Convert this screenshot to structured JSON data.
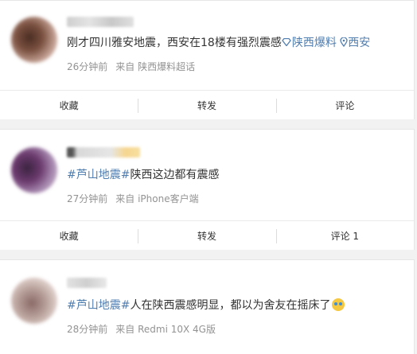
{
  "posts": [
    {
      "segments": [
        {
          "text": "刚才四川雅安地震，西安在18楼有强烈震感",
          "type": "plain"
        },
        {
          "text": "陕西爆料",
          "type": "link-blue",
          "icon": "diamond-icon"
        },
        {
          "text": " ",
          "type": "plain"
        },
        {
          "text": "西安",
          "type": "link-blue",
          "icon": "location-icon"
        }
      ],
      "time": "26分钟前",
      "source": "来自 陕西爆料超话",
      "actions": {
        "favorite": "收藏",
        "repost": "转发",
        "comment": "评论"
      }
    },
    {
      "segments": [
        {
          "text": "#芦山地震#",
          "type": "link-blue"
        },
        {
          "text": "陕西这边都有震感",
          "type": "plain"
        }
      ],
      "name_prefix": "N",
      "time": "27分钟前",
      "source": "来自 iPhone客户端",
      "actions": {
        "favorite": "收藏",
        "repost": "转发",
        "comment": "评论 1"
      }
    },
    {
      "segments": [
        {
          "text": "#芦山地震#",
          "type": "link-blue"
        },
        {
          "text": "人在陕西震感明显，都以为舍友在摇床了",
          "type": "plain"
        }
      ],
      "time": "28分钟前",
      "source": "来自 Redmi 10X 4G版",
      "emoji": "crying-face-icon"
    }
  ],
  "colors": {
    "link": "#507daf",
    "meta": "#939393",
    "text": "#333333"
  }
}
